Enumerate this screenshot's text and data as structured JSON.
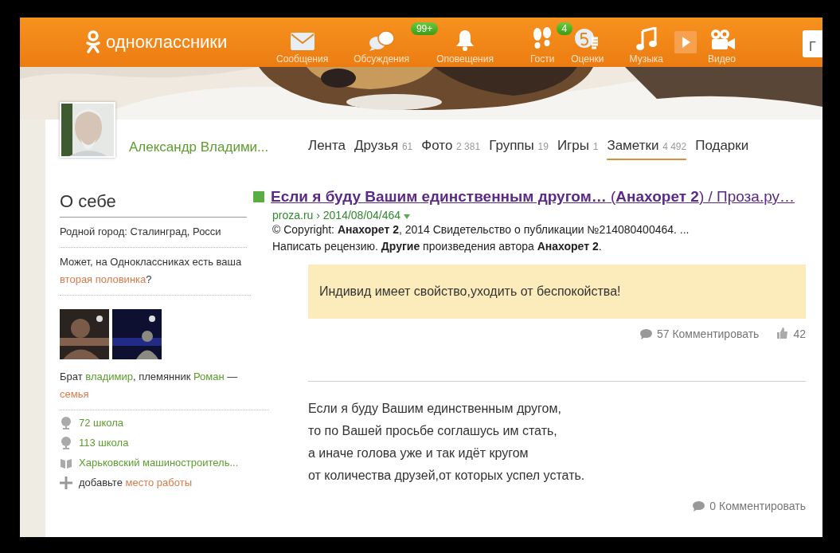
{
  "header": {
    "logo": "одноклассники",
    "nav": [
      {
        "label": "Сообщения"
      },
      {
        "label": "Обсуждения",
        "badge": "99+"
      },
      {
        "label": "Оповещения"
      },
      {
        "label": "Гости",
        "badge": "4"
      },
      {
        "label": "Оценки"
      },
      {
        "label": "Музыка"
      },
      {
        "label": "Видео"
      }
    ],
    "search_field": {
      "value": "Г"
    }
  },
  "profile": {
    "name": "Александр Владими...",
    "tabs": [
      {
        "label": "Лента",
        "selected": false
      },
      {
        "label": "Друзья",
        "count": "61",
        "selected": false
      },
      {
        "label": "Фото",
        "count": "2 381",
        "selected": false
      },
      {
        "label": "Группы",
        "count": "19",
        "selected": false
      },
      {
        "label": "Игры",
        "count": "1",
        "selected": false
      },
      {
        "label": "Заметки",
        "count": "4 492",
        "selected": true
      },
      {
        "label": "Подарки",
        "selected": false
      }
    ]
  },
  "about": {
    "title": "О себе",
    "hometown": "Родной город: Сталинград, Росси",
    "partner": [
      {
        "kind": "text",
        "text": "Может, на Одноклассниках есть ваша "
      },
      {
        "kind": "link",
        "text": "вторая половинка"
      },
      {
        "kind": "text",
        "text": "?"
      }
    ],
    "family": [
      {
        "kind": "text",
        "text": "Брат "
      },
      {
        "kind": "person",
        "text": "владимир"
      },
      {
        "kind": "text",
        "text": ", племянник "
      },
      {
        "kind": "person",
        "text": "Роман"
      },
      {
        "kind": "text",
        "text": " — "
      },
      {
        "kind": "link",
        "text": "семья"
      }
    ],
    "education": [
      {
        "kind": "school",
        "label": "72 школа"
      },
      {
        "kind": "school",
        "label": "113 школа"
      },
      {
        "kind": "university",
        "label": "Харьковский машиностроитель..."
      }
    ],
    "add_work": {
      "text": "добавьте",
      "link": "место работы"
    }
  },
  "notes": [
    {
      "kind": "search",
      "title": "**Если я буду Вашим единственным другом…** (**Анахорет 2**) / Проза.ру…",
      "url": "proza.ru › 2014/08/04/464",
      "snippet": [
        "© Copyright: **Анахорет 2**, 2014 Свидетельство о публикации №214080400464. ...",
        "Написать рецензию. **Другие** произведения автора **Анахорет 2**."
      ],
      "quote": "Индивид имеет свойство,уходить от беспокойства!",
      "comments": "57 Комментировать",
      "likes": "42"
    },
    {
      "kind": "poem",
      "lines": [
        "Если я буду Вашим единственным другом,",
        "то по Вашей просьбе соглашусь им стать,",
        "а иначе голова уже и так идёт кругом",
        "от количества друзей,от которых успел устать."
      ],
      "comments": "0 Комментировать"
    }
  ]
}
